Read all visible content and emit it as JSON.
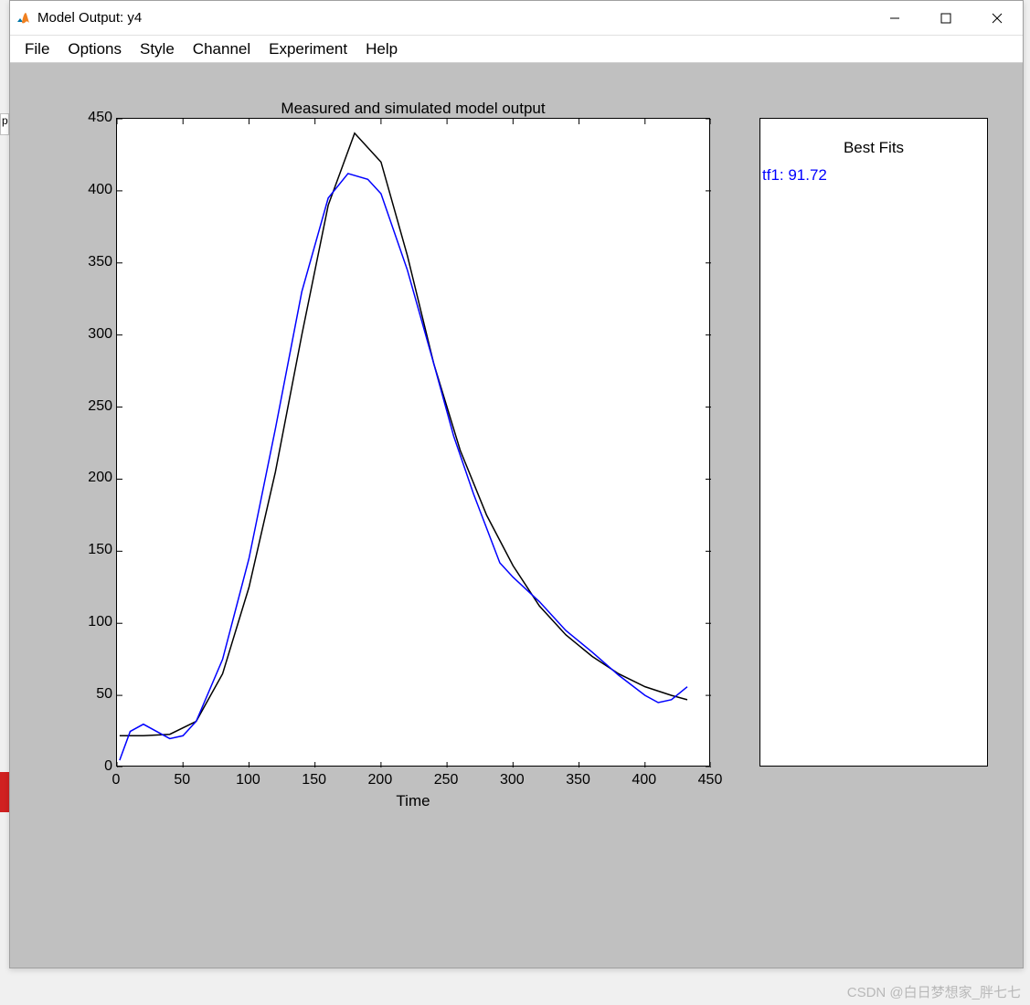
{
  "window": {
    "title": "Model Output: y4"
  },
  "menu": {
    "items": [
      "File",
      "Options",
      "Style",
      "Channel",
      "Experiment",
      "Help"
    ]
  },
  "legend": {
    "title": "Best Fits",
    "entries": [
      "tf1: 91.72"
    ]
  },
  "watermark": "CSDN @白日梦想家_胖七七",
  "chart_data": {
    "type": "line",
    "title": "Measured and simulated model output",
    "xlabel": "Time",
    "ylabel": "",
    "xlim": [
      0,
      450
    ],
    "ylim": [
      0,
      450
    ],
    "xticks": [
      0,
      50,
      100,
      150,
      200,
      250,
      300,
      350,
      400,
      450
    ],
    "yticks": [
      0,
      50,
      100,
      150,
      200,
      250,
      300,
      350,
      400,
      450
    ],
    "series": [
      {
        "name": "measured",
        "color": "#000000",
        "x": [
          2,
          20,
          40,
          60,
          80,
          100,
          120,
          140,
          160,
          180,
          200,
          220,
          240,
          260,
          280,
          300,
          320,
          340,
          360,
          380,
          400,
          420,
          432
        ],
        "y": [
          22,
          22,
          23,
          32,
          65,
          125,
          205,
          300,
          390,
          440,
          420,
          355,
          280,
          220,
          175,
          140,
          112,
          92,
          77,
          65,
          56,
          50,
          47
        ]
      },
      {
        "name": "tf1",
        "color": "#0000ff",
        "x": [
          2,
          10,
          20,
          30,
          40,
          50,
          60,
          80,
          100,
          120,
          140,
          160,
          175,
          190,
          200,
          220,
          240,
          255,
          270,
          290,
          300,
          320,
          340,
          360,
          380,
          400,
          410,
          420,
          432
        ],
        "y": [
          5,
          25,
          30,
          25,
          20,
          22,
          32,
          75,
          145,
          235,
          330,
          395,
          412,
          408,
          398,
          345,
          280,
          230,
          190,
          142,
          132,
          115,
          95,
          80,
          64,
          50,
          45,
          47,
          56
        ]
      }
    ]
  }
}
